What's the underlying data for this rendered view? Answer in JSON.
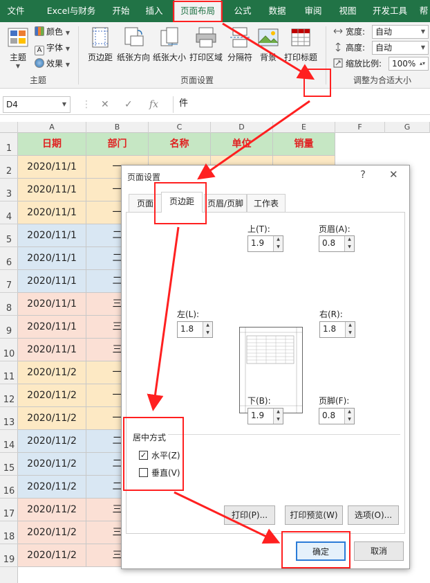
{
  "ribbon_tabs": [
    "文件",
    "Excel与财务",
    "开始",
    "插入",
    "页面布局",
    "公式",
    "数据",
    "审阅",
    "视图",
    "开发工具",
    "帮"
  ],
  "active_tab": "页面布局",
  "ribbon": {
    "theme_group": {
      "label": "主题",
      "theme_btn": "主题",
      "colors": "颜色",
      "fonts": "字体",
      "effects": "效果"
    },
    "page_setup_group": {
      "label": "页面设置",
      "buttons": [
        "页边距",
        "纸张方向",
        "纸张大小",
        "打印区域",
        "分隔符",
        "背景",
        "打印标题"
      ]
    },
    "scale_group": {
      "label": "调整为合适大小",
      "width_label": "宽度:",
      "width_value": "自动",
      "height_label": "高度:",
      "height_value": "自动",
      "scale_label": "缩放比例:",
      "scale_value": "100%"
    }
  },
  "formula_bar": {
    "name_box": "D4",
    "cancel": "✕",
    "enter": "✓",
    "fx": "fx",
    "content": "件"
  },
  "columns": [
    "A",
    "B",
    "C",
    "D",
    "E",
    "F",
    "G"
  ],
  "row_numbers": [
    "1",
    "2",
    "3",
    "4",
    "5",
    "6",
    "7",
    "8",
    "9",
    "10",
    "11",
    "12",
    "13",
    "14",
    "15",
    "16",
    "17",
    "18",
    "19"
  ],
  "table_headers": [
    "日期",
    "部门",
    "名称",
    "单位",
    "销量"
  ],
  "table_rows": [
    {
      "date": "2020/11/1",
      "dept": "一",
      "bg": "#fde9c4"
    },
    {
      "date": "2020/11/1",
      "dept": "一",
      "bg": "#fde9c4"
    },
    {
      "date": "2020/11/1",
      "dept": "一",
      "bg": "#fde9c4"
    },
    {
      "date": "2020/11/1",
      "dept": "二",
      "bg": "#d9e7f3"
    },
    {
      "date": "2020/11/1",
      "dept": "二",
      "bg": "#d9e7f3"
    },
    {
      "date": "2020/11/1",
      "dept": "二",
      "bg": "#d9e7f3"
    },
    {
      "date": "2020/11/1",
      "dept": "三",
      "bg": "#fbe0d5"
    },
    {
      "date": "2020/11/1",
      "dept": "三",
      "bg": "#fbe0d5"
    },
    {
      "date": "2020/11/1",
      "dept": "三",
      "bg": "#fbe0d5"
    },
    {
      "date": "2020/11/2",
      "dept": "一",
      "bg": "#fde9c4"
    },
    {
      "date": "2020/11/2",
      "dept": "一",
      "bg": "#fde9c4"
    },
    {
      "date": "2020/11/2",
      "dept": "一",
      "bg": "#fde9c4"
    },
    {
      "date": "2020/11/2",
      "dept": "二",
      "bg": "#d9e7f3"
    },
    {
      "date": "2020/11/2",
      "dept": "二",
      "bg": "#d9e7f3"
    },
    {
      "date": "2020/11/2",
      "dept": "二",
      "bg": "#d9e7f3"
    },
    {
      "date": "2020/11/2",
      "dept": "三",
      "bg": "#fbe0d5"
    },
    {
      "date": "2020/11/2",
      "dept": "三",
      "bg": "#fbe0d5"
    },
    {
      "date": "2020/11/2",
      "dept": "三",
      "bg": "#fbe0d5"
    }
  ],
  "dialog": {
    "title": "页面设置",
    "help": "?",
    "close": "✕",
    "tabs": [
      "页面",
      "页边距",
      "页眉/页脚",
      "工作表"
    ],
    "active_tab": "页边距",
    "top_label": "上(T):",
    "top_value": "1.9",
    "header_label": "页眉(A):",
    "header_value": "0.8",
    "left_label": "左(L):",
    "left_value": "1.8",
    "right_label": "右(R):",
    "right_value": "1.8",
    "bottom_label": "下(B):",
    "bottom_value": "1.9",
    "footer_label": "页脚(F):",
    "footer_value": "0.8",
    "center_title": "居中方式",
    "horizontal_label": "水平(Z)",
    "horizontal_checked": true,
    "vertical_label": "垂直(V)",
    "vertical_checked": false,
    "print_btn": "打印(P)...",
    "preview_btn": "打印预览(W)",
    "options_btn": "选项(O)...",
    "ok_btn": "确定",
    "cancel_btn": "取消"
  },
  "colors": {
    "excel_green": "#217346",
    "annotation_red": "#ff2020",
    "header_text_red": "#e02020"
  }
}
